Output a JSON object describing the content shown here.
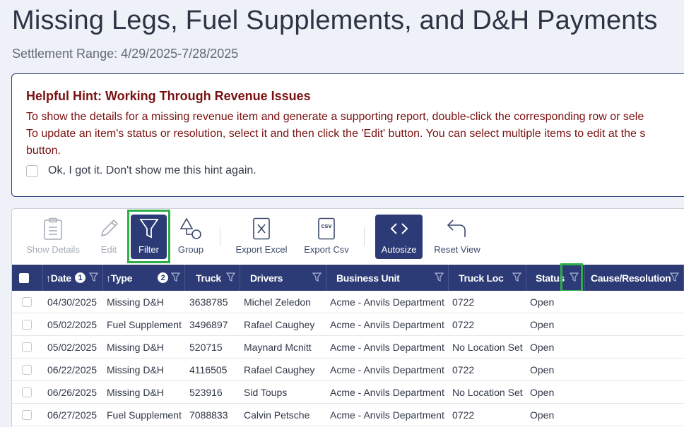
{
  "page": {
    "title": "Missing Legs, Fuel Supplements, and D&H Payments",
    "subtitle": "Settlement Range: 4/29/2025-7/28/2025"
  },
  "hint": {
    "title": "Helpful Hint: Working Through Revenue Issues",
    "line1": "To show the details for a missing revenue item and generate a supporting report, double-click the corresponding row or sele",
    "line2": "To update an item's status or resolution, select it and then click the 'Edit' button. You can select multiple items to edit at the s",
    "line3": "button.",
    "dismiss_label": "Ok, I got it. Don't show me this hint again."
  },
  "toolbar": {
    "show_details": "Show Details",
    "edit": "Edit",
    "filter": "Filter",
    "group": "Group",
    "export_excel": "Export Excel",
    "export_csv": "Export Csv",
    "csv_glyph": "csv",
    "autosize": "Autosize",
    "reset_view": "Reset View"
  },
  "columns": {
    "date": "Date",
    "date_sort_order": "1",
    "type": "Type",
    "type_sort_order": "2",
    "truck": "Truck",
    "drivers": "Drivers",
    "business_unit": "Business Unit",
    "truck_loc": "Truck Loc",
    "status": "Status",
    "cause_resolution": "Cause/Resolution",
    "sort_arrow": "↑"
  },
  "rows": [
    {
      "date": "04/30/2025",
      "type": "Missing D&H",
      "truck": "3638785",
      "drivers": "Michel Zeledon",
      "business_unit": "Acme - Anvils Department",
      "truck_loc": "0722",
      "status": "Open",
      "cause": ""
    },
    {
      "date": "05/02/2025",
      "type": "Fuel Supplement",
      "truck": "3496897",
      "drivers": "Rafael Caughey",
      "business_unit": "Acme - Anvils Department",
      "truck_loc": "0722",
      "status": "Open",
      "cause": ""
    },
    {
      "date": "05/02/2025",
      "type": "Missing D&H",
      "truck": "520715",
      "drivers": "Maynard Mcnitt",
      "business_unit": "Acme - Anvils Department",
      "truck_loc": "No Location Set",
      "status": "Open",
      "cause": ""
    },
    {
      "date": "06/22/2025",
      "type": "Missing D&H",
      "truck": "4116505",
      "drivers": "Rafael Caughey",
      "business_unit": "Acme - Anvils Department",
      "truck_loc": "0722",
      "status": "Open",
      "cause": ""
    },
    {
      "date": "06/26/2025",
      "type": "Missing D&H",
      "truck": "523916",
      "drivers": "Sid Toups",
      "business_unit": "Acme - Anvils Department",
      "truck_loc": "No Location Set",
      "status": "Open",
      "cause": ""
    },
    {
      "date": "06/27/2025",
      "type": "Fuel Supplement",
      "truck": "7088833",
      "drivers": "Calvin Petsche",
      "business_unit": "Acme - Anvils Department",
      "truck_loc": "0722",
      "status": "Open",
      "cause": ""
    }
  ],
  "colors": {
    "header_bg": "#2c3a75",
    "hint_text": "#7a1111",
    "highlight": "#2fae47"
  },
  "icons": {
    "show_details": "clipboard-icon",
    "edit": "pencil-icon",
    "filter": "filter-funnel-icon",
    "group": "group-shapes-icon",
    "export_excel": "excel-file-icon",
    "export_csv": "csv-file-icon",
    "autosize": "code-brackets-icon",
    "reset_view": "undo-arrow-icon"
  }
}
